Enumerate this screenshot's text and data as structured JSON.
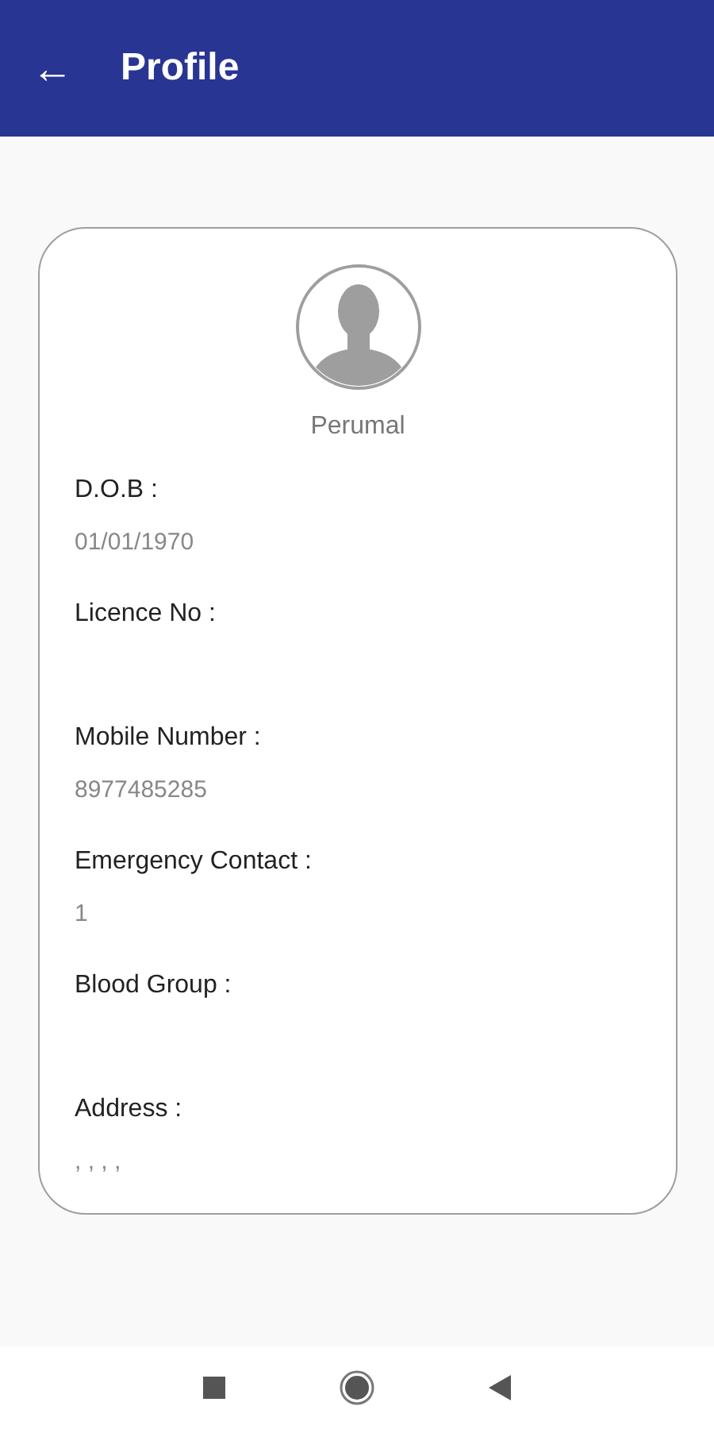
{
  "app_bar": {
    "back_icon": "←",
    "title": "Profile"
  },
  "profile": {
    "name": "Perumal"
  },
  "fields": [
    {
      "label": "D.O.B :",
      "value": "01/01/1970"
    },
    {
      "label": "Licence No :"
    },
    {
      "label": "Mobile Number :",
      "value": "8977485285"
    },
    {
      "label": "Emergency Contact :",
      "value": "1"
    },
    {
      "label": "Blood Group :"
    },
    {
      "label": "Address :",
      "value": ", , , ,"
    }
  ]
}
